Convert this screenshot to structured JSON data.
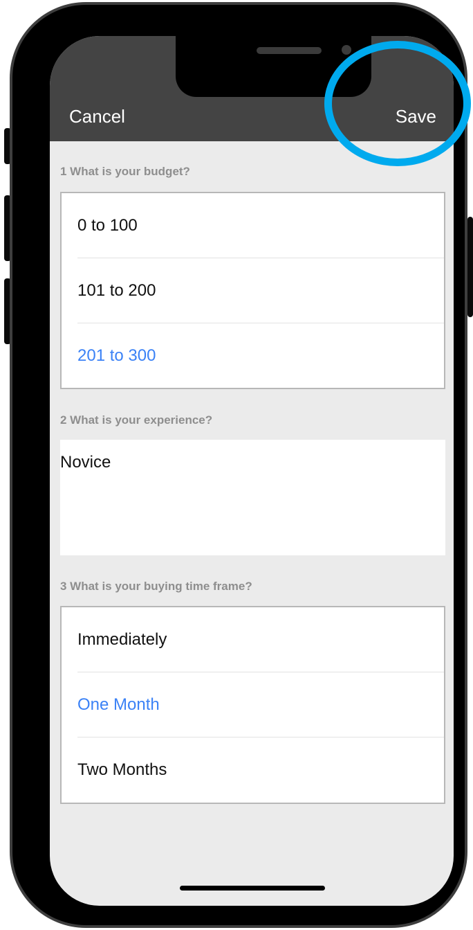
{
  "nav": {
    "cancel_label": "Cancel",
    "save_label": "Save"
  },
  "questions": [
    {
      "label": "1 What is your budget?",
      "options": [
        "0 to 100",
        "101 to 200",
        "201 to 300"
      ],
      "selected": "201 to 300"
    },
    {
      "label": "2 What is your experience?",
      "answer": "Novice"
    },
    {
      "label": "3 What is your buying time frame?",
      "options": [
        "Immediately",
        "One Month",
        "Two Months"
      ],
      "selected": "One Month"
    }
  ],
  "colors": {
    "nav_background": "#444444",
    "selected_text": "#3b82f6",
    "highlight_ring": "#00aaee",
    "screen_background": "#ebebeb"
  }
}
